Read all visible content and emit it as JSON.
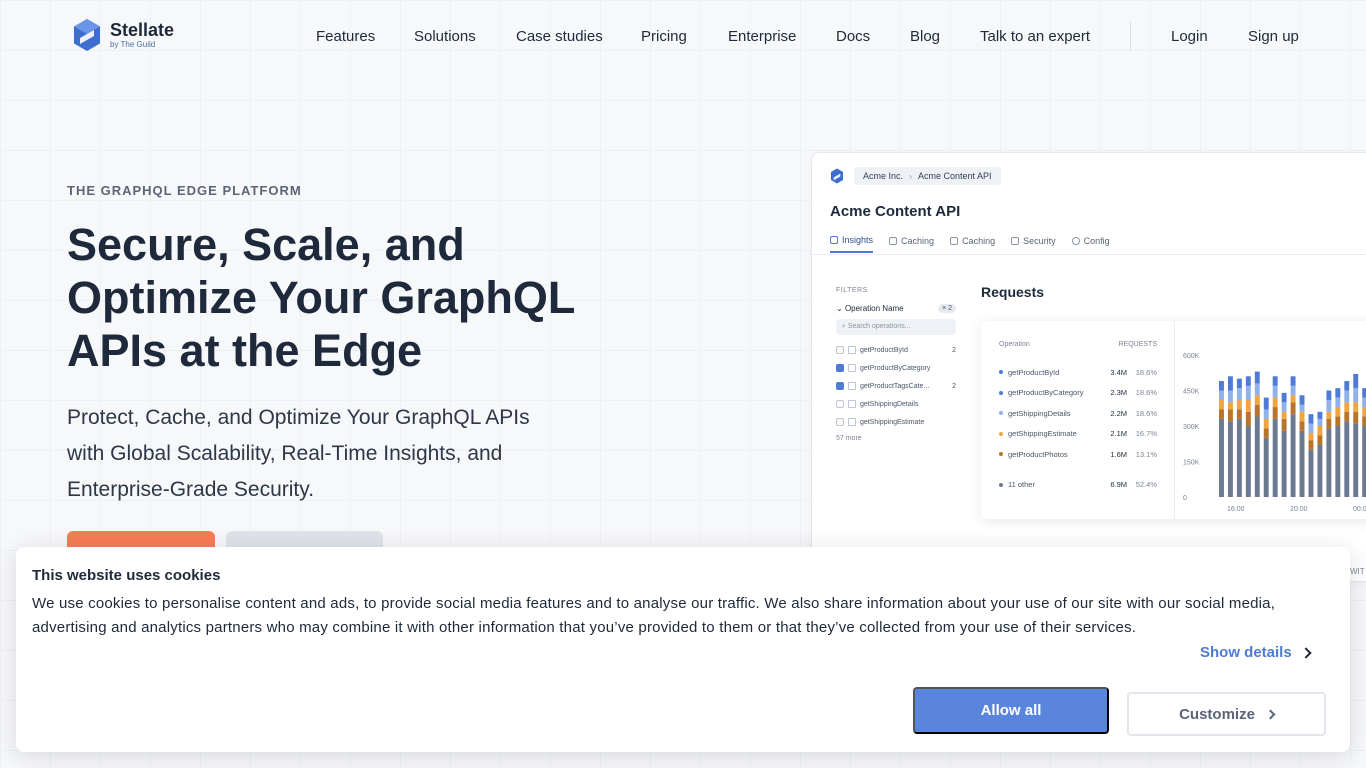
{
  "brand": {
    "name": "Stellate",
    "sub": "by The Guild",
    "color": "#4f7ad6"
  },
  "nav": {
    "items": [
      "Features",
      "Solutions",
      "Case studies",
      "Pricing",
      "Enterprise",
      "Docs",
      "Blog",
      "Talk to an expert"
    ],
    "login": "Login",
    "signup": "Sign up"
  },
  "hero": {
    "eyebrow": "THE GRAPHQL EDGE PLATFORM",
    "headline": "Secure, Scale, and Optimize Your GraphQL APIs at the Edge",
    "subhead": "Protect, Cache, and Optimize Your GraphQL APIs with Global Scalability, Real-Time Insights, and Enterprise-Grade Security.",
    "primary_color": "#f87c56"
  },
  "dashboard": {
    "crumb1": "Acme Inc.",
    "crumb2": "Acme Content API",
    "title": "Acme Content API",
    "tabs": [
      "Insights",
      "Caching",
      "Caching",
      "Security",
      "Config"
    ],
    "filters": {
      "title": "FILTERS",
      "op_label": "Operation Name",
      "op_badge": "× 2",
      "search_placeholder": "Search operations...",
      "items": [
        {
          "label": "getProductById",
          "checked": false,
          "count": "2"
        },
        {
          "label": "getProductByCategory",
          "checked": true,
          "count": ""
        },
        {
          "label": "getProductTagsCate...",
          "checked": true,
          "count": "2"
        },
        {
          "label": "getShippingDetails",
          "checked": false,
          "count": ""
        },
        {
          "label": "getShippingEstimate",
          "checked": false,
          "count": ""
        }
      ],
      "more": "57 more"
    },
    "requests": {
      "title": "Requests",
      "col_op": "Operation",
      "col_req": "REQUESTS",
      "rows": [
        {
          "op": "getProductById",
          "val": "3.4M",
          "pct": "18.6%",
          "color": "#4f7ad6"
        },
        {
          "op": "getProductByCategory",
          "val": "2.3M",
          "pct": "18.6%",
          "color": "#4f7ad6"
        },
        {
          "op": "getShippingDetails",
          "val": "2.2M",
          "pct": "18.6%",
          "color": "#8fb1ec"
        },
        {
          "op": "getShippingEstimate",
          "val": "2.1M",
          "pct": "16.7%",
          "color": "#f0a640"
        },
        {
          "op": "getProductPhotos",
          "val": "1.6M",
          "pct": "13.1%",
          "color": "#b8742a"
        },
        {
          "op": "11 other",
          "val": "6.9M",
          "pct": "52.4%",
          "color": "#6b7a90"
        }
      ]
    }
  },
  "chart_data": {
    "type": "bar",
    "y_ticks": [
      "600K",
      "450K",
      "300K",
      "150K",
      "0"
    ],
    "x_ticks": [
      "16:00",
      "20:00",
      "00:00"
    ],
    "ylim": [
      0,
      600000
    ],
    "stack_colors": [
      "#6b7a90",
      "#b8742a",
      "#f0a640",
      "#8fb1ec",
      "#4f7ad6"
    ],
    "bars": [
      [
        330000,
        40000,
        40000,
        40000,
        40000
      ],
      [
        320000,
        50000,
        30000,
        50000,
        60000
      ],
      [
        330000,
        40000,
        40000,
        50000,
        40000
      ],
      [
        300000,
        60000,
        50000,
        60000,
        40000
      ],
      [
        340000,
        50000,
        40000,
        50000,
        50000
      ],
      [
        250000,
        40000,
        40000,
        40000,
        50000
      ],
      [
        330000,
        50000,
        40000,
        50000,
        40000
      ],
      [
        280000,
        50000,
        30000,
        40000,
        40000
      ],
      [
        350000,
        50000,
        30000,
        40000,
        40000
      ],
      [
        280000,
        40000,
        40000,
        30000,
        40000
      ],
      [
        200000,
        40000,
        30000,
        40000,
        40000
      ],
      [
        220000,
        40000,
        40000,
        30000,
        30000
      ],
      [
        290000,
        40000,
        30000,
        50000,
        40000
      ],
      [
        300000,
        40000,
        40000,
        40000,
        40000
      ],
      [
        320000,
        40000,
        40000,
        50000,
        40000
      ],
      [
        310000,
        50000,
        40000,
        60000,
        60000
      ],
      [
        300000,
        40000,
        40000,
        40000,
        40000
      ],
      [
        300000,
        40000,
        30000,
        40000,
        40000
      ],
      [
        280000,
        40000,
        40000,
        40000,
        40000
      ],
      [
        300000,
        40000,
        30000,
        40000,
        30000
      ]
    ]
  },
  "cookie": {
    "title": "This website uses cookies",
    "text": "We use cookies to personalise content and ads, to provide social media features and to analyse our traffic. We also share information about your use of our site with our social media, advertising and analytics partners who may combine it with other information that you’ve provided to them or that they’ve collected from your use of their services.",
    "show_details": "Show details",
    "allow_all": "Allow all",
    "customize": "Customize",
    "accent": "#5a85dc"
  },
  "peek": "WIT"
}
